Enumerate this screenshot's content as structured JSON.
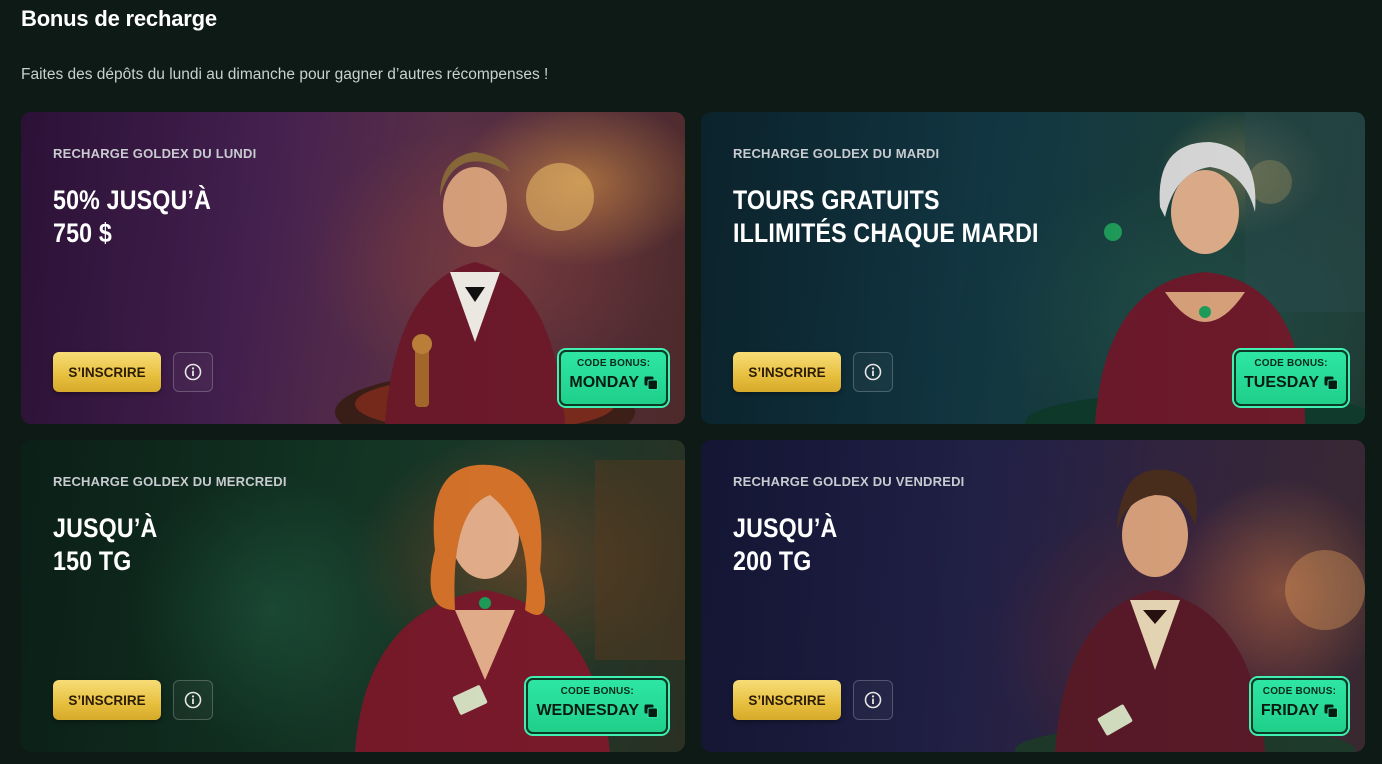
{
  "page": {
    "title": "Bonus de recharge",
    "subtitle": "Faites des dépôts du lundi au dimanche pour gagner d’autres récompenses !"
  },
  "cards": [
    {
      "label": "RECHARGE GOLDEX DU LUNDI",
      "headline": [
        "50% JUSQU’À",
        "750 $"
      ],
      "signup_label": "S’INSCRIRE",
      "info_icon": "info-icon",
      "code_caption": "CODE BONUS:",
      "code": "MONDAY",
      "copy_icon": "copy-icon"
    },
    {
      "label": "RECHARGE GOLDEX DU MARDI",
      "headline": [
        "TOURS GRATUITS",
        "ILLIMITÉS CHAQUE MARDI"
      ],
      "signup_label": "S’INSCRIRE",
      "info_icon": "info-icon",
      "code_caption": "CODE BONUS:",
      "code": "TUESDAY",
      "copy_icon": "copy-icon"
    },
    {
      "label": "RECHARGE GOLDEX DU MERCREDI",
      "headline": [
        "JUSQU’À",
        "150 TG"
      ],
      "signup_label": "S’INSCRIRE",
      "info_icon": "info-icon",
      "code_caption": "CODE BONUS:",
      "code": "WEDNESDAY",
      "copy_icon": "copy-icon"
    },
    {
      "label": "RECHARGE GOLDEX DU VENDREDI",
      "headline": [
        "JUSQU’À",
        "200 TG"
      ],
      "signup_label": "S’INSCRIRE",
      "info_icon": "info-icon",
      "code_caption": "CODE BONUS:",
      "code": "FRIDAY",
      "copy_icon": "copy-icon"
    }
  ],
  "colors": {
    "background": "#0d1a15",
    "button_gold": "#e7bf3f",
    "code_green": "#2ee6a4"
  }
}
